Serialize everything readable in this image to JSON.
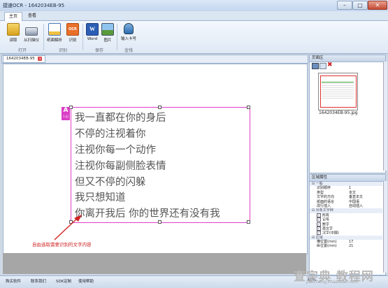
{
  "window": {
    "title": "捷速OCR - 1642034EB-95",
    "min": "–",
    "max": "□",
    "close": "✕"
  },
  "ribbon_tabs": [
    "主页",
    "查看"
  ],
  "ribbon": {
    "buttons": [
      {
        "label": "读取",
        "icon": "read-folder-icon"
      },
      {
        "label": "从扫描仪",
        "icon": "scanner-icon"
      },
      {
        "label": "纸面解析",
        "icon": "page-analysis-icon"
      },
      {
        "label": "识别",
        "icon": "ocr-icon",
        "icon_text": "OCR"
      },
      {
        "label": "Word",
        "icon": "word-icon",
        "icon_text": "W"
      },
      {
        "label": "图片",
        "icon": "picture-icon"
      },
      {
        "label": "输入卡号",
        "icon": "card-number-icon"
      }
    ],
    "groups": [
      "打开",
      "识别",
      "保存",
      "金钱"
    ]
  },
  "document_tab": {
    "label": "1642034EB-95",
    "close": "x"
  },
  "ocr_region": {
    "badge_letter": "A",
    "badge_text": "1.|||",
    "lines": [
      "我一直都在你的身后",
      "不停的注视着你",
      "注视你每一个动作",
      "注视你每副侧脸表情",
      "但又不停的闪躲",
      "我只想知道",
      "你离开我后 你的世界还有没有我"
    ]
  },
  "annotation": "自由选取需要识别的文字内容",
  "pages_panel": {
    "title": "页面区",
    "thumbnail_label": "1642034EB-95.jpg"
  },
  "attributes_panel": {
    "title": "区域属性",
    "groups": [
      {
        "name": "一般",
        "rows": [
          {
            "key": "识别顺序",
            "value": "1"
          },
          {
            "key": "类型",
            "value": "本文"
          },
          {
            "key": "文字的方向",
            "value": "垂直本文"
          },
          {
            "key": "纸面的语言",
            "value": "中国语"
          },
          {
            "key": "改行插入",
            "value": "自动插入"
          }
        ]
      },
      {
        "name": "对象文字种",
        "rows": [
          {
            "key": "所有",
            "checked": true
          },
          {
            "key": "记号",
            "checked": true
          },
          {
            "key": "数字",
            "checked": true
          },
          {
            "key": "英文字",
            "checked": true
          },
          {
            "key": "汉字(中国)",
            "checked": true
          }
        ]
      },
      {
        "name": "区域",
        "rows": [
          {
            "key": "横位置(mm)",
            "value": "17"
          },
          {
            "key": "纵位置(mm)",
            "value": "21"
          }
        ]
      }
    ]
  },
  "statusbar": {
    "links": [
      "购买软件",
      "联系我们",
      "SDK定制",
      "使用帮助"
    ],
    "zoom": "60%"
  },
  "watermark": {
    "text": "查字典 教程网",
    "url": "jiaocheng.chazidian.com"
  }
}
